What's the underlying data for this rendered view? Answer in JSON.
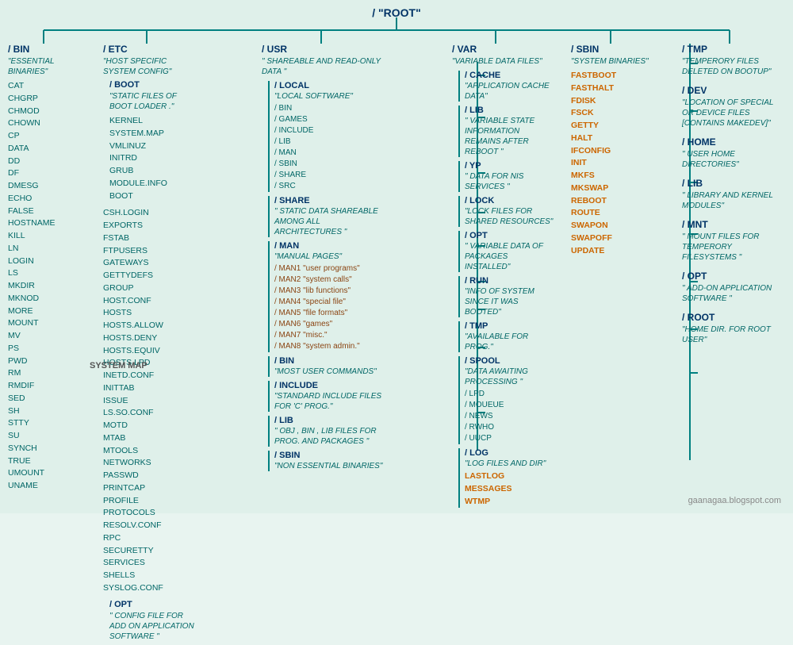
{
  "root": {
    "label": "/  \"ROOT\""
  },
  "bin": {
    "title": "/ BIN",
    "desc": "\"ESSENTIAL BINARIES\"",
    "files": [
      "CAT",
      "CHGRP",
      "CHMOD",
      "CHOWN",
      "CP",
      "DATA",
      "DD",
      "DF",
      "DMESG",
      "ECHO",
      "FALSE",
      "HOSTNAME",
      "KILL",
      "LN",
      "LOGIN",
      "LS",
      "MKDIR",
      "MKNOD",
      "MORE",
      "MOUNT",
      "MV",
      "PS",
      "PWD",
      "RM",
      "RMDIF",
      "SED",
      "SH",
      "STTY",
      "SU",
      "SYNCH",
      "TRUE",
      "UMOUNT",
      "UNAME"
    ]
  },
  "etc": {
    "title": "/ ETC",
    "desc": "\"HOST SPECIFIC SYSTEM CONFIG\"",
    "files": [
      "CSH.LOGIN",
      "EXPORTS",
      "FSTAB",
      "FTPUSERS",
      "GATEWAYS",
      "GETTYDEFS",
      "GROUP",
      "HOST.CONF",
      "HOSTS",
      "HOSTS.ALLOW",
      "HOSTS.DENY",
      "HOSTS.EQUIV",
      "HOSTS.LPD",
      "INETD.CONF",
      "INITTAB",
      "ISSUE",
      "LS.SO.CONF",
      "MOTD",
      "MTAB",
      "MTOOLS",
      "NETWORKS",
      "PASSWD",
      "PRINTCAP",
      "PROFILE",
      "PROTOCOLS",
      "RESOLV.CONF",
      "RPC",
      "SECURETTY",
      "SERVICES",
      "SHELLS",
      "SYSLOG.CONF"
    ],
    "opt": {
      "title": "/ OPT",
      "desc": "\" CONFIG FILE FOR ADD ON APPLICATION SOFTWARE \""
    }
  },
  "boot": {
    "title": "/ BOOT",
    "desc": "\"STATIC FILES OF BOOT LOADER .\"",
    "files": [
      "KERNEL",
      "SYSTEM.MAP",
      "VMLINUZ",
      "INITRD",
      "GRUB",
      "MODULE.INFO",
      "BOOT"
    ]
  },
  "usr": {
    "title": "/ USR",
    "desc": "\" SHAREABLE AND READ-ONLY DATA \"",
    "local": {
      "title": "/ LOCAL",
      "desc": "\"LOCAL SOFTWARE\"",
      "subdirs": [
        "/ BIN",
        "/ GAMES",
        "/ INCLUDE",
        "/ LIB",
        "/ MAN",
        "/ SBIN",
        "/ SHARE",
        "/ SRC"
      ]
    },
    "share": {
      "title": "/ SHARE",
      "desc": "\" STATIC DATA SHAREABLE AMONG ALL ARCHITECTURES \""
    },
    "man": {
      "title": "/ MAN",
      "desc": "\"MANUAL PAGES\"",
      "subdirs": [
        "/ MAN1 \"user programs\"",
        "/ MAN2 \"system calls\"",
        "/ MAN3 \"lib functions\"",
        "/ MAN4 \"special file\"",
        "/ MAN5 \"file formats\"",
        "/ MAN6 \"games\"",
        "/ MAN7 \"misc.\"",
        "/ MAN8 \"system admin.\""
      ]
    },
    "bin": {
      "title": "/ BIN",
      "desc": "\"MOST USER COMMANDS\""
    },
    "include": {
      "title": "/ INCLUDE",
      "desc": "\"STANDARD INCLUDE FILES FOR 'C' PROG.\""
    },
    "lib": {
      "title": "/ LIB",
      "desc": "\" OBJ , BIN , LIB FILES FOR PROG. AND PACKAGES \""
    },
    "sbin": {
      "title": "/ SBIN",
      "desc": "\"NON ESSENTIAL BINARIES\""
    }
  },
  "var": {
    "title": "/ VAR",
    "desc": "\"VARIABLE DATA FILES\"",
    "cache": {
      "title": "/ CACHE",
      "desc": "\"APPLICATION CACHE DATA\""
    },
    "lib": {
      "title": "/ LIB",
      "desc": "\" VARIABLE STATE INFORMATION REMAINS AFTER REBOOT \""
    },
    "yp": {
      "title": "/ YP",
      "desc": "\" DATA FOR NIS SERVICES \""
    },
    "lock": {
      "title": "/ LOCK",
      "desc": "\"LOCK FILES FOR SHARED RESOURCES\""
    },
    "opt": {
      "title": "/ OPT",
      "desc": "\" VARIABLE DATA OF PACKAGES INSTALLED\""
    },
    "run": {
      "title": "/ RUN",
      "desc": "\"INFO OF SYSTEM SINCE IT WAS BOOTED\""
    },
    "tmp": {
      "title": "/ TMP",
      "desc": "\"AVAILABLE FOR PROG.\""
    },
    "spool": {
      "title": "/ SPOOL",
      "desc": "\"DATA AWAITING PROCESSING \"",
      "subdirs": [
        "/ LPD",
        "/ MOUEUE",
        "/ NEWS",
        "/ RWHO",
        "/ UUCP"
      ]
    },
    "log": {
      "title": "/ LOG",
      "desc": "\"LOG FILES AND DIR\"",
      "files_orange": [
        "LASTLOG",
        "MESSAGES",
        "WTMP"
      ]
    }
  },
  "sbin": {
    "title": "/ SBIN",
    "desc": "\"SYSTEM BINARIES\"",
    "files_orange": [
      "FASTBOOT",
      "FASTHALT",
      "FDISK",
      "FSCK",
      "GETTY",
      "HALT",
      "IFCONFIG",
      "INIT",
      "MKFS",
      "MKSWAP",
      "REBOOT",
      "ROUTE",
      "SWAPON",
      "SWAPOFF",
      "UPDATE"
    ]
  },
  "right_col": {
    "tmp": {
      "title": "/ TMP",
      "desc": "\"TEMPERORY FILES DELETED ON BOOTUP\""
    },
    "dev": {
      "title": "/ DEV",
      "desc": "\"LOCATION OF SPECIAL OR DEVICE FILES [CONTAINS MAKEDEV]\""
    },
    "home": {
      "title": "/ HOME",
      "desc": "\" USER HOME DIRECTORIES\""
    },
    "lib": {
      "title": "/ LIB",
      "desc": "\"  LIBRARY AND KERNEL MODULES\""
    },
    "mnt": {
      "title": "/ MNT",
      "desc": "\"  MOUNT FILES FOR TEMPERORY FILESYSTEMS \""
    },
    "opt": {
      "title": "/ OPT",
      "desc": "\" ADD-ON APPLICATION SOFTWARE \""
    },
    "root_dir": {
      "title": "/ ROOT",
      "desc": "\"HOME DIR. FOR ROOT USER\""
    }
  },
  "watermark": "gaanagaa.blogspot.com",
  "system_map": "SYSTEM MAP"
}
